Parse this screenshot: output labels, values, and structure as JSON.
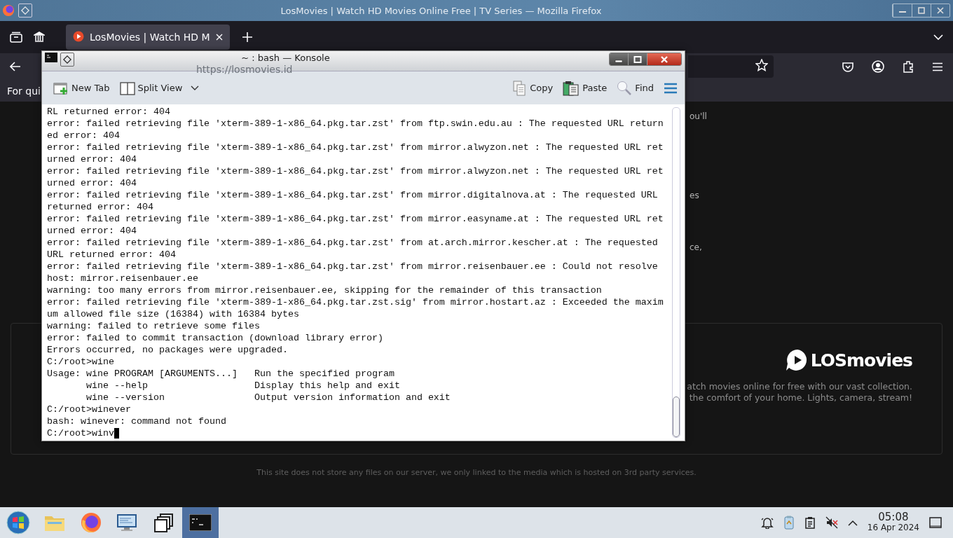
{
  "firefox": {
    "window_title": "LosMovies | Watch HD Movies Online Free | TV Series — Mozilla Firefox",
    "tabs": [
      {
        "title": "LosMovies | Watch HD M",
        "selected": true
      }
    ],
    "url": "https://losmovies.id",
    "notice": "For qui",
    "page": {
      "side_texts": [
        "ou'll",
        "es",
        "ce,"
      ],
      "logo": "LOSmovies",
      "tagline": [
        "atch movies online for free with our vast collection.",
        "the comfort of your home. Lights, camera, stream!"
      ],
      "footer": "This site does not store any files on our server, we only linked to the media which is hosted on 3rd party services."
    }
  },
  "konsole": {
    "title": "~ : bash — Konsole",
    "toolbar": [
      {
        "kind": "newtab",
        "label": "New Tab"
      },
      {
        "kind": "split",
        "label": "Split View"
      },
      {
        "kind": "copy",
        "label": "Copy"
      },
      {
        "kind": "paste",
        "label": "Paste"
      },
      {
        "kind": "find",
        "label": "Find"
      }
    ],
    "lines": [
      "RL returned error: 404",
      "error: failed retrieving file 'xterm-389-1-x86_64.pkg.tar.zst' from ftp.swin.edu.au : The requested URL return",
      "ed error: 404",
      "error: failed retrieving file 'xterm-389-1-x86_64.pkg.tar.zst' from mirror.alwyzon.net : The requested URL ret",
      "urned error: 404",
      "error: failed retrieving file 'xterm-389-1-x86_64.pkg.tar.zst' from mirror.alwyzon.net : The requested URL ret",
      "urned error: 404",
      "error: failed retrieving file 'xterm-389-1-x86_64.pkg.tar.zst' from mirror.digitalnova.at : The requested URL",
      "returned error: 404",
      "error: failed retrieving file 'xterm-389-1-x86_64.pkg.tar.zst' from mirror.easyname.at : The requested URL ret",
      "urned error: 404",
      "error: failed retrieving file 'xterm-389-1-x86_64.pkg.tar.zst' from at.arch.mirror.kescher.at : The requested",
      "URL returned error: 404",
      "error: failed retrieving file 'xterm-389-1-x86_64.pkg.tar.zst' from mirror.reisenbauer.ee : Could not resolve",
      "host: mirror.reisenbauer.ee",
      "warning: too many errors from mirror.reisenbauer.ee, skipping for the remainder of this transaction",
      "error: failed retrieving file 'xterm-389-1-x86_64.pkg.tar.zst.sig' from mirror.hostart.az : Exceeded the maxim",
      "um allowed file size (16384) with 16384 bytes",
      "warning: failed to retrieve some files",
      "error: failed to commit transaction (download library error)",
      "Errors occurred, no packages were upgraded.",
      "C:/root>wine",
      "Usage: wine PROGRAM [ARGUMENTS...]   Run the specified program",
      "       wine --help                   Display this help and exit",
      "       wine --version                Output version information and exit",
      "C:/root>winever",
      "bash: winever: command not found"
    ],
    "input_line": "C:/root>winv"
  },
  "taskbar": {
    "apps": [
      {
        "kind": "start",
        "active": false
      },
      {
        "kind": "files",
        "active": false
      },
      {
        "kind": "firefox",
        "active": false
      },
      {
        "kind": "monitor",
        "active": false
      },
      {
        "kind": "windows",
        "active": false
      },
      {
        "kind": "terminal",
        "active": true
      }
    ],
    "time": "05:08",
    "date": "16 Apr 2024"
  }
}
